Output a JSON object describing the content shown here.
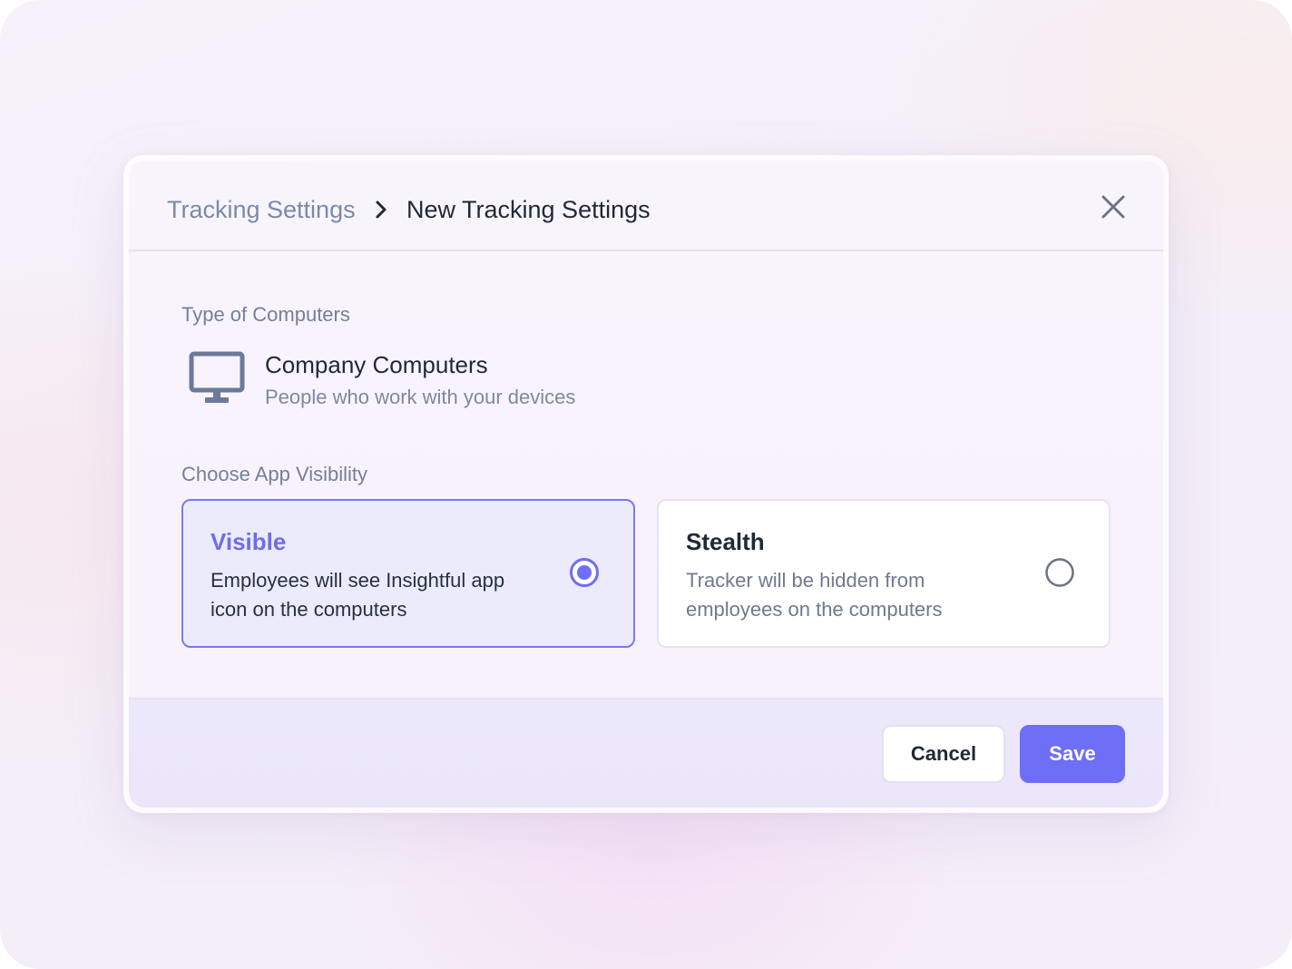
{
  "breadcrumb": {
    "parent": "Tracking Settings",
    "current": "New Tracking Settings"
  },
  "computers": {
    "section_label": "Type of Computers",
    "title": "Company Computers",
    "subtitle": "People who work with your devices",
    "icon": "monitor-icon"
  },
  "visibility": {
    "section_label": "Choose App Visibility",
    "selected": "visible",
    "options": [
      {
        "id": "visible",
        "title": "Visible",
        "description": "Employees will see Insightful app icon on the computers",
        "selected": true
      },
      {
        "id": "stealth",
        "title": "Stealth",
        "description": "Tracker will be hidden from employees on the computers",
        "selected": false
      }
    ]
  },
  "actions": {
    "cancel_label": "Cancel",
    "save_label": "Save"
  },
  "colors": {
    "accent": "#6f6ef6",
    "selected_card_bg": "#ecebfc",
    "heading_text": "#1f2937",
    "muted_text": "#74809b"
  }
}
